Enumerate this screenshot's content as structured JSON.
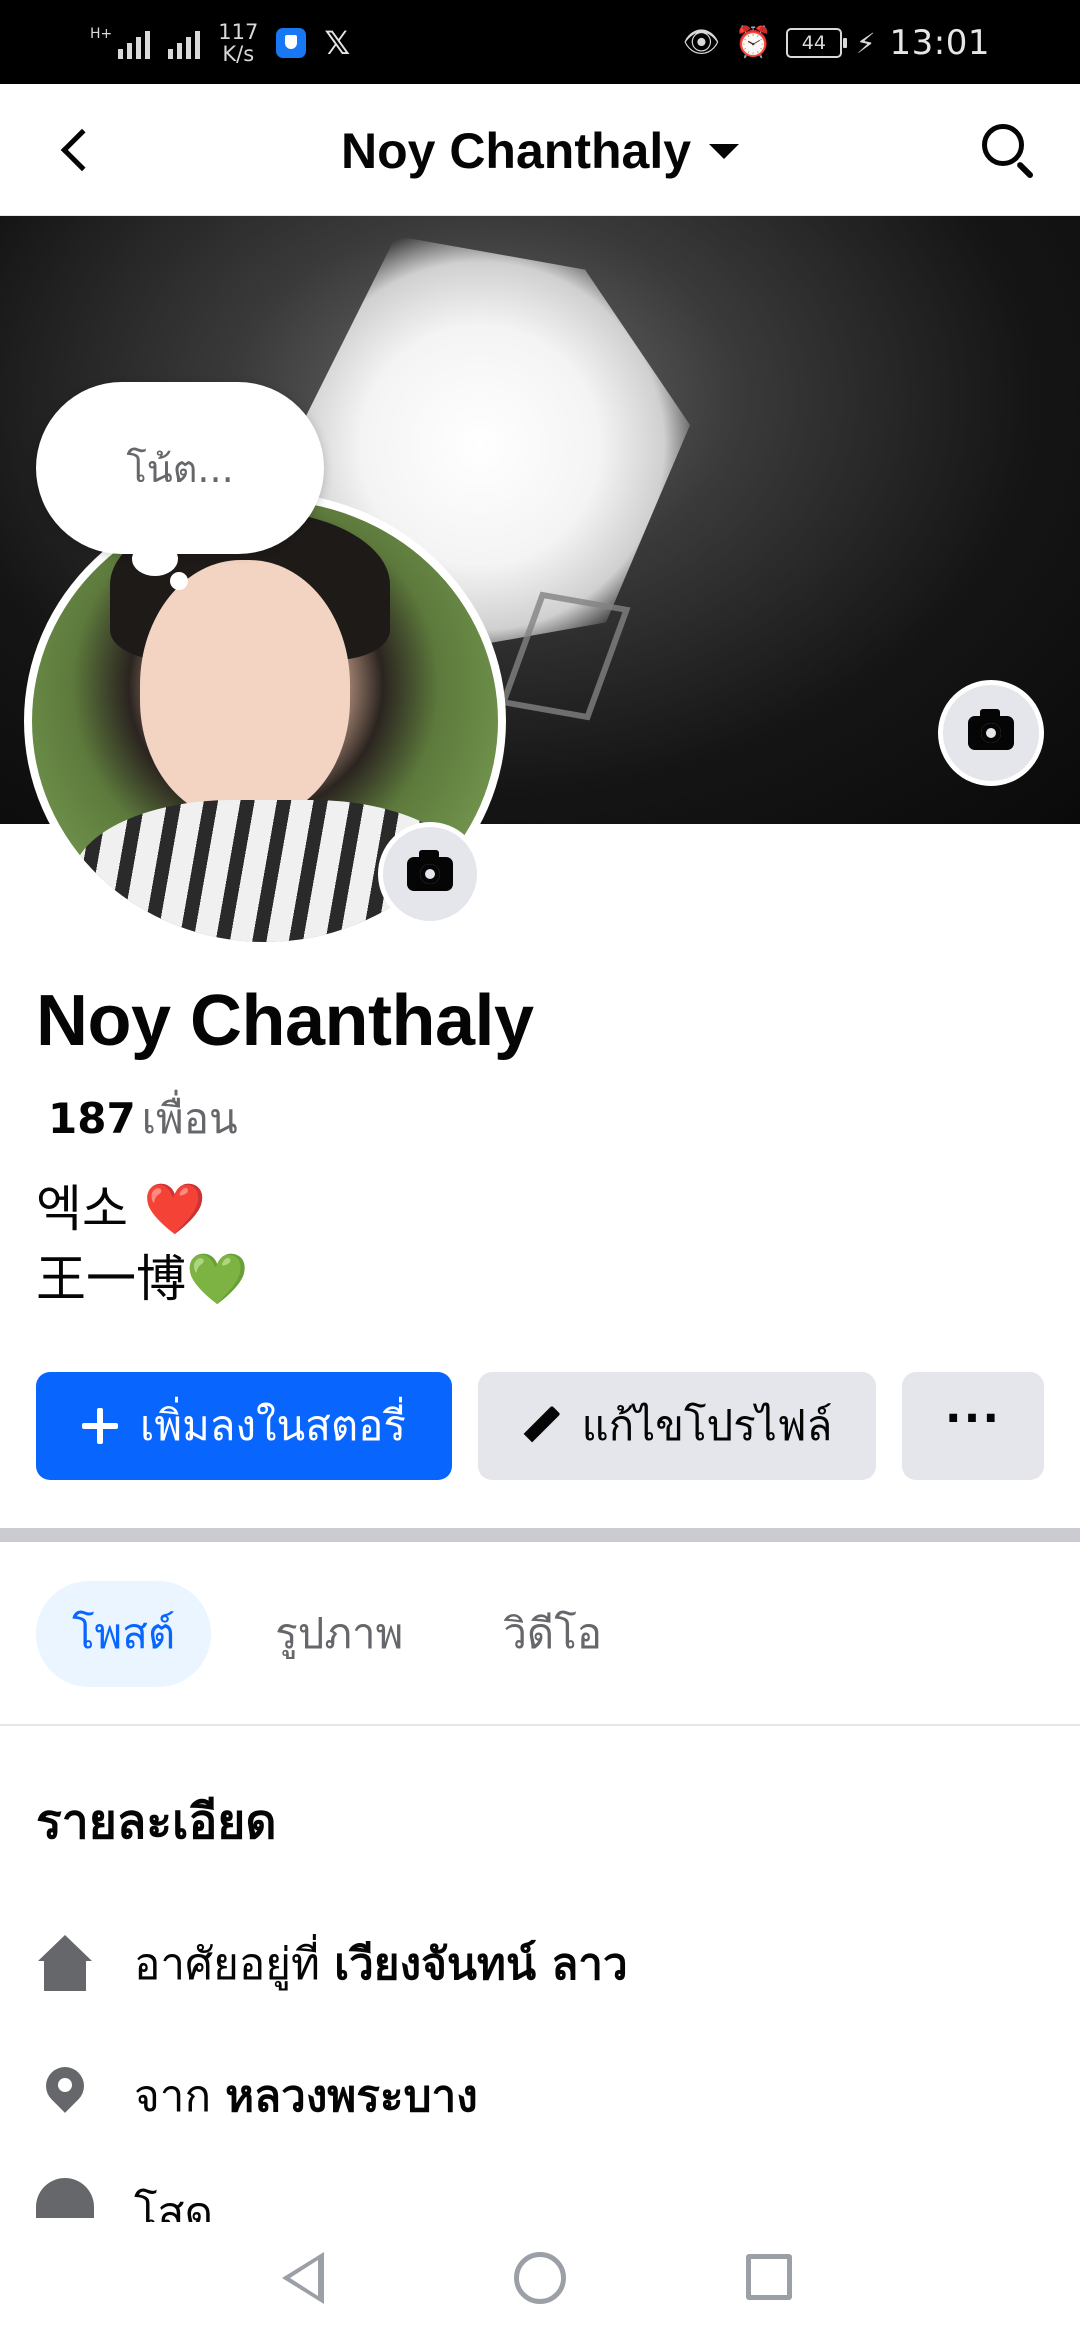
{
  "status_bar": {
    "net_speed_value": "117",
    "net_speed_unit": "K/s",
    "app_icon": "x-logo",
    "app_glyph": "𝕏",
    "battery": "44",
    "time": "13:01"
  },
  "header": {
    "title": "Noy Chanthaly"
  },
  "note": {
    "placeholder": "โน้ต..."
  },
  "profile": {
    "name": "Noy Chanthaly",
    "friends_count": "187",
    "friends_label": "เพื่อน",
    "bio_line1": "엑소",
    "bio_line1_emoji": "❤️",
    "bio_line2": "王一博",
    "bio_line2_emoji": "💚"
  },
  "buttons": {
    "add_story": "เพิ่มลงในสตอรี่",
    "edit_profile": "แก้ไขโปรไฟล์",
    "more": "···"
  },
  "tabs": [
    {
      "label": "โพสต์",
      "active": true
    },
    {
      "label": "รูปภาพ",
      "active": false
    },
    {
      "label": "วิดีโอ",
      "active": false
    }
  ],
  "details": {
    "title": "รายละเอียด",
    "rows": [
      {
        "icon": "home-icon",
        "prefix": "อาศัยอยู่ที่",
        "value": "เวียงจันทน์ ลาว"
      },
      {
        "icon": "location-pin-icon",
        "prefix": "จาก",
        "value": "หลวงพระบาง"
      },
      {
        "icon": "heart-icon",
        "prefix": "โสด",
        "value": ""
      }
    ]
  },
  "colors": {
    "primary": "#0866ff",
    "secondary_bg": "#e4e6eb",
    "text_secondary": "#65676b",
    "tab_active_bg": "#ebf5ff"
  }
}
